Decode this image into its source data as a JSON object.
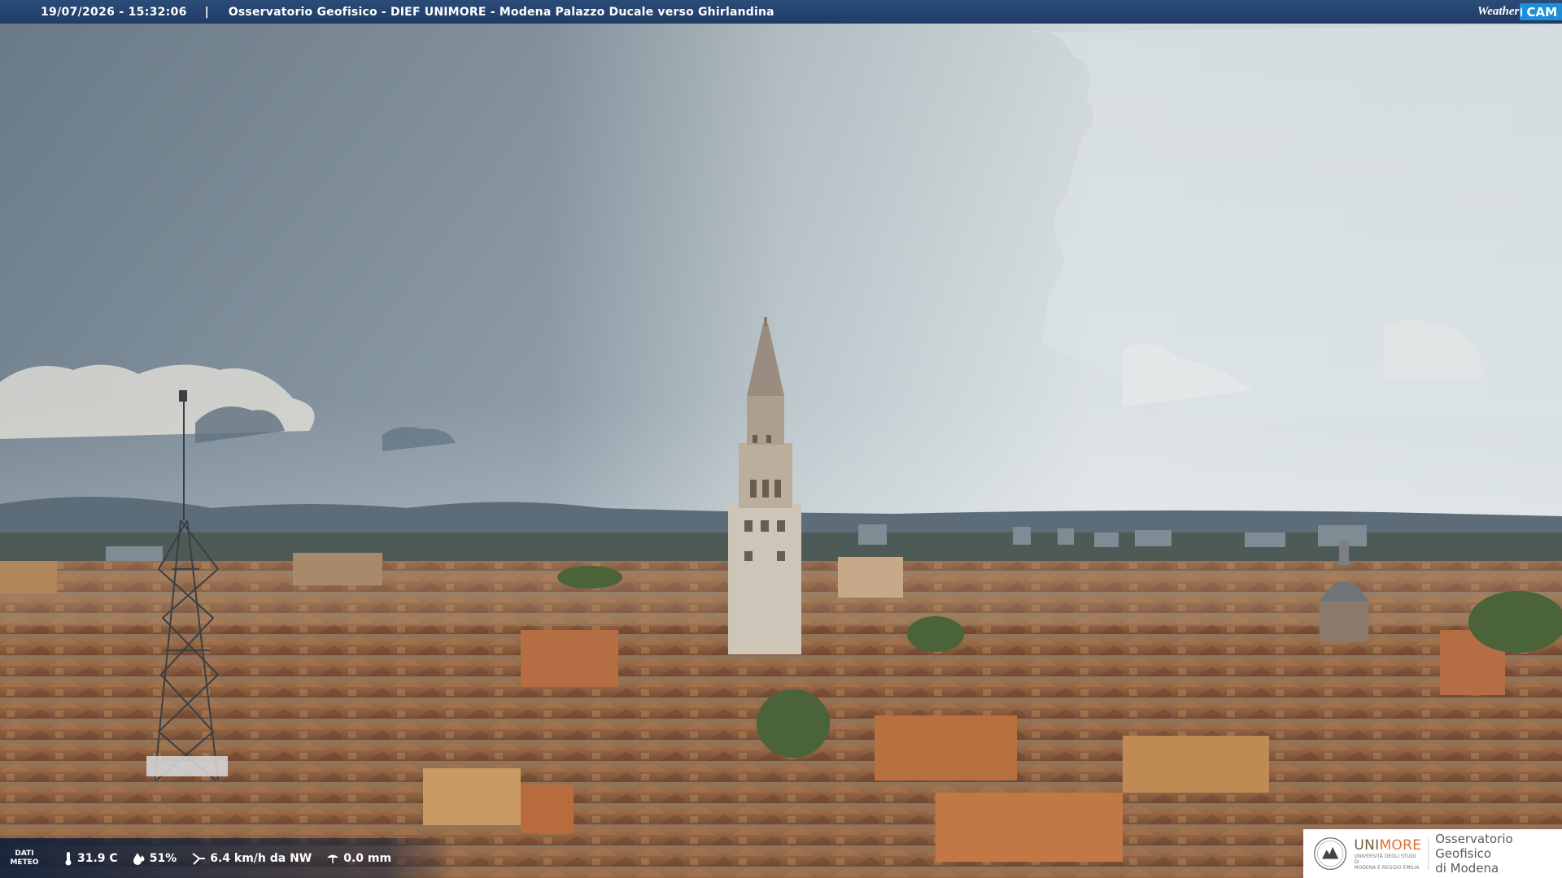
{
  "caption": {
    "timestamp": "19/07/2026 - 15:32:06",
    "separator": "|",
    "location": "Osservatorio Geofisico - DIEF UNIMORE - Modena Palazzo Ducale verso Ghirlandina"
  },
  "brand": {
    "part1": "Weather",
    "part2": "CAM",
    "accent": "#1d8fd6"
  },
  "meteo": {
    "label_line1": "DATI",
    "label_line2": "METEO",
    "temperature": "31.9 C",
    "humidity": "51%",
    "wind": "6.4 km/h da NW",
    "rain": "0.0 mm"
  },
  "logo": {
    "name_a": "UNI",
    "name_b": "MORE",
    "sub1": "UNIVERSITÀ DEGLI STUDI DI",
    "sub2": "MODENA E REGGIO EMILIA",
    "obs_line1": "Osservatorio Geofisico",
    "obs_line2": "di Modena"
  },
  "icons": {
    "temperature": "thermometer-icon",
    "humidity": "droplet-icon",
    "wind": "wind-vane-icon",
    "rain": "rain-gauge-icon"
  },
  "colors": {
    "bar": "#1f3c66",
    "brand_orange": "#e2712b",
    "brand_brown": "#7a5a33"
  }
}
